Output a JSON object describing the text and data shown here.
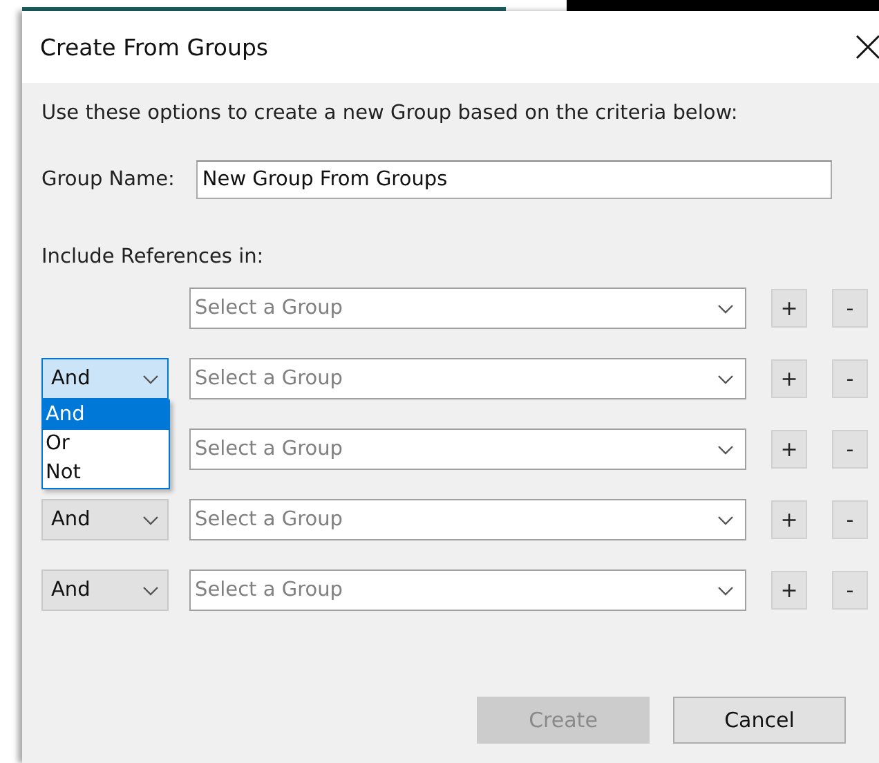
{
  "window": {
    "title": "Create From Groups"
  },
  "intro": "Use these options to create a new Group based on the criteria below:",
  "group_name": {
    "label": "Group Name:",
    "value": "New Group From Groups"
  },
  "references_label": "Include References in:",
  "rows": [
    {
      "group": {
        "placeholder": "Select a Group"
      },
      "add": "+",
      "remove": "-"
    },
    {
      "operator": {
        "value": "And",
        "expanded": true,
        "options": [
          {
            "label": "And",
            "selected": true
          },
          {
            "label": "Or",
            "selected": false
          },
          {
            "label": "Not",
            "selected": false
          }
        ]
      },
      "group": {
        "placeholder": "Select a Group"
      },
      "add": "+",
      "remove": "-"
    },
    {
      "group": {
        "placeholder": "Select a Group"
      },
      "add": "+",
      "remove": "-"
    },
    {
      "operator": {
        "value": "And",
        "expanded": false
      },
      "group": {
        "placeholder": "Select a Group"
      },
      "add": "+",
      "remove": "-"
    },
    {
      "operator": {
        "value": "And",
        "expanded": false
      },
      "group": {
        "placeholder": "Select a Group"
      },
      "add": "+",
      "remove": "-"
    }
  ],
  "buttons": [
    {
      "label": "Create",
      "disabled": true
    },
    {
      "label": "Cancel",
      "disabled": false
    }
  ]
}
